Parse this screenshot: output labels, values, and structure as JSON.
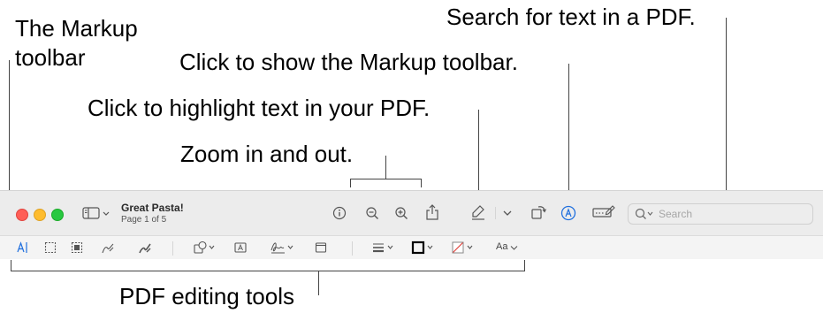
{
  "callouts": {
    "markup_toolbar": "The Markup\ntoolbar",
    "search": "Search for text in a PDF.",
    "show_markup": "Click to show the Markup toolbar.",
    "highlight": "Click to highlight text in your PDF.",
    "zoom": "Zoom in and out.",
    "pdf_tools": "PDF editing tools"
  },
  "window": {
    "title": "Great Pasta!",
    "subtitle": "Page 1 of 5",
    "search_placeholder": "Search",
    "font_menu_label": "Aa"
  },
  "colors": {
    "close": "#ff5f57",
    "minimize": "#febc2e",
    "zoom": "#28c840",
    "accent": "#1f6fde"
  },
  "icons": {
    "sidebar": "sidebar-icon",
    "info": "info-icon",
    "zoom_out": "zoom-out-icon",
    "zoom_in": "zoom-in-icon",
    "share": "share-icon",
    "highlight": "highlighter-icon",
    "rotate": "rotate-icon",
    "markup": "markup-icon",
    "form": "form-fill-icon",
    "search": "search-icon"
  }
}
